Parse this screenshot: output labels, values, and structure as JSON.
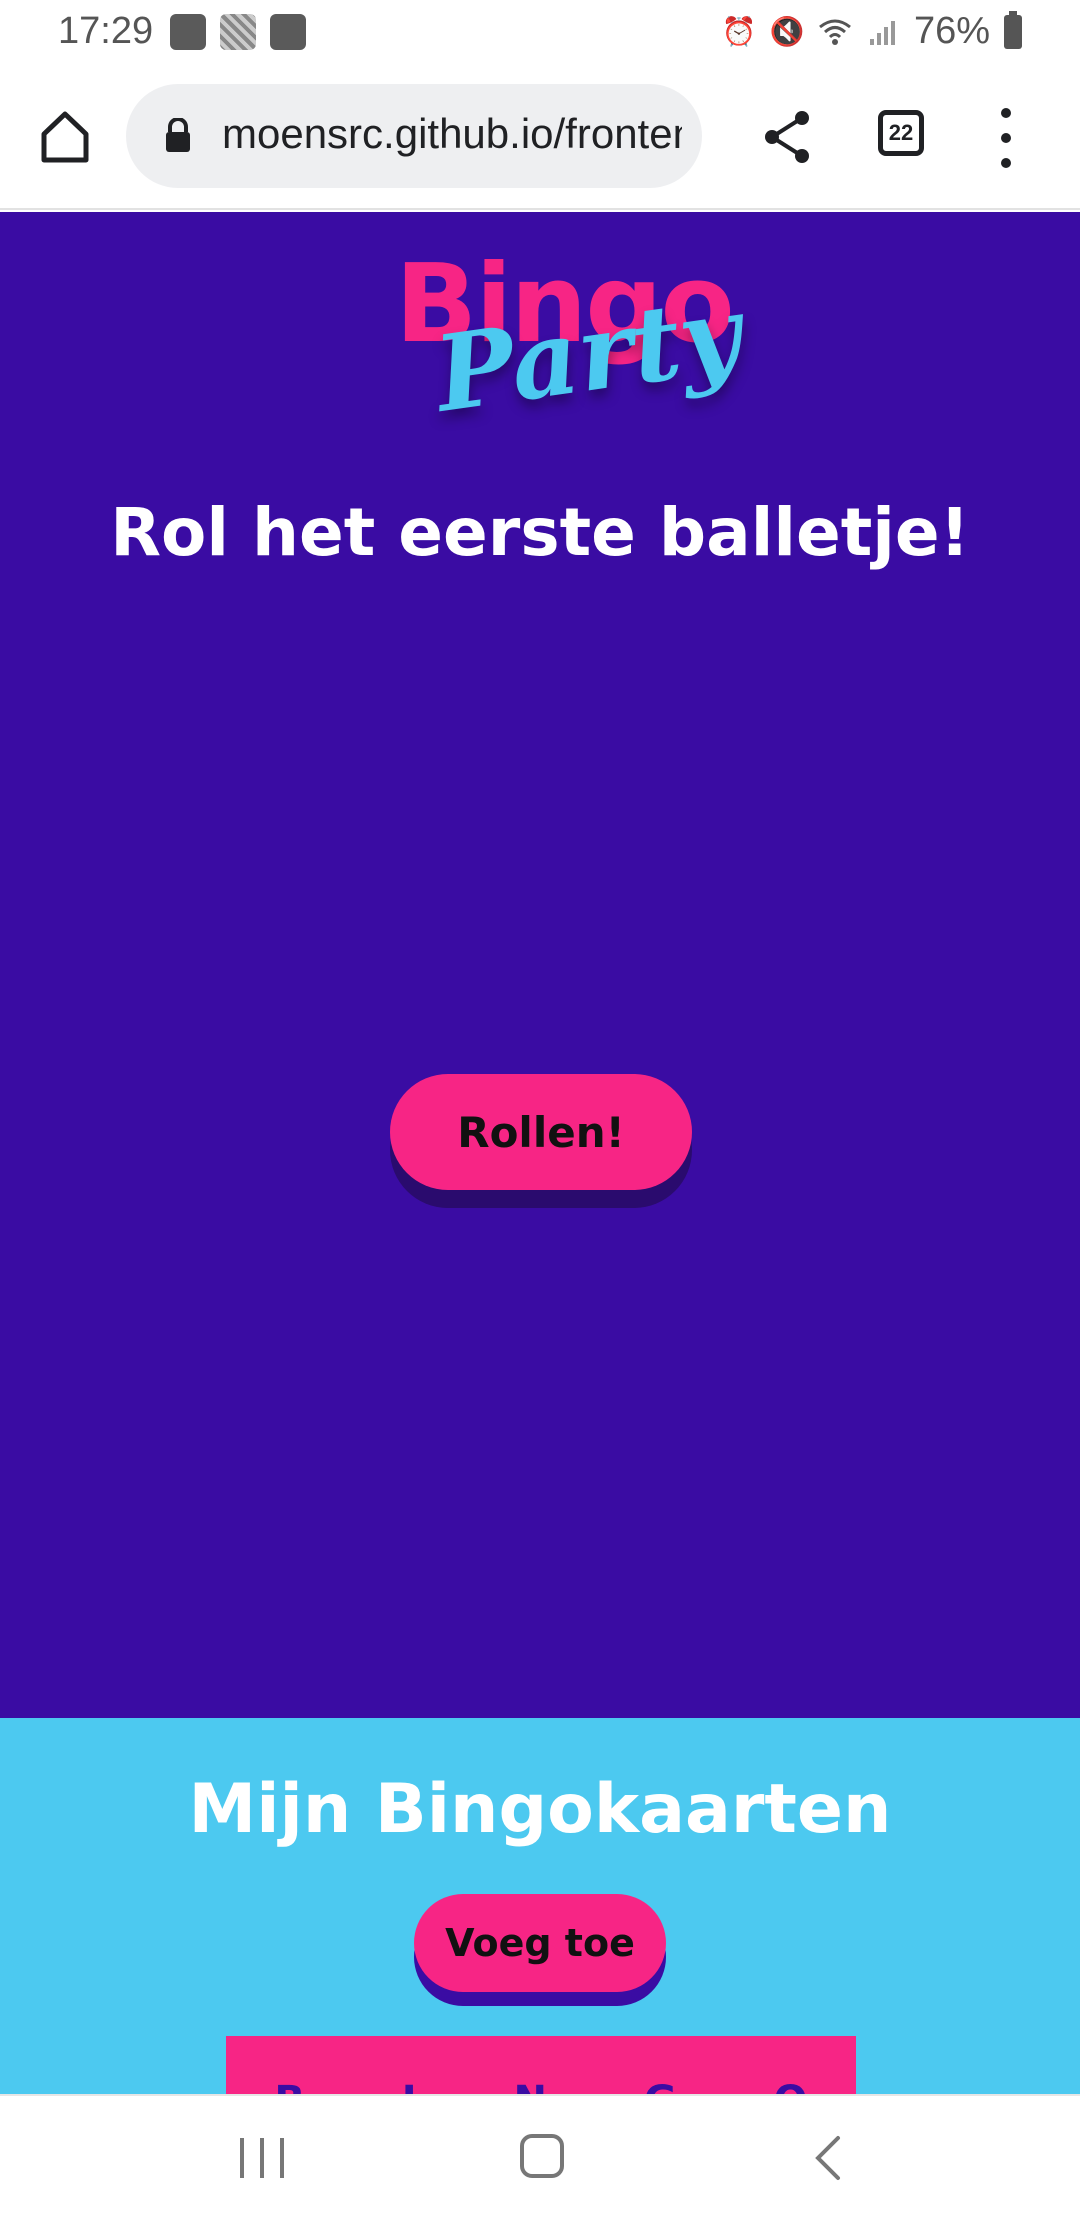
{
  "status_bar": {
    "time": "17:29",
    "battery": "76%"
  },
  "browser": {
    "url": "moensrc.github.io/frontend",
    "tab_count": "22"
  },
  "logo": {
    "bingo": "Bingo",
    "party": "Party"
  },
  "hero": {
    "title": "Rol het eerste balletje!",
    "roll_label": "Rollen!"
  },
  "cards": {
    "title": "Mijn Bingokaarten",
    "add_label": "Voeg toe",
    "card_letters": [
      "B",
      "I",
      "N",
      "G",
      "O"
    ]
  },
  "colors": {
    "hero_bg": "#3a0ca3",
    "cards_bg": "#4cc9f0",
    "accent": "#f72585"
  }
}
